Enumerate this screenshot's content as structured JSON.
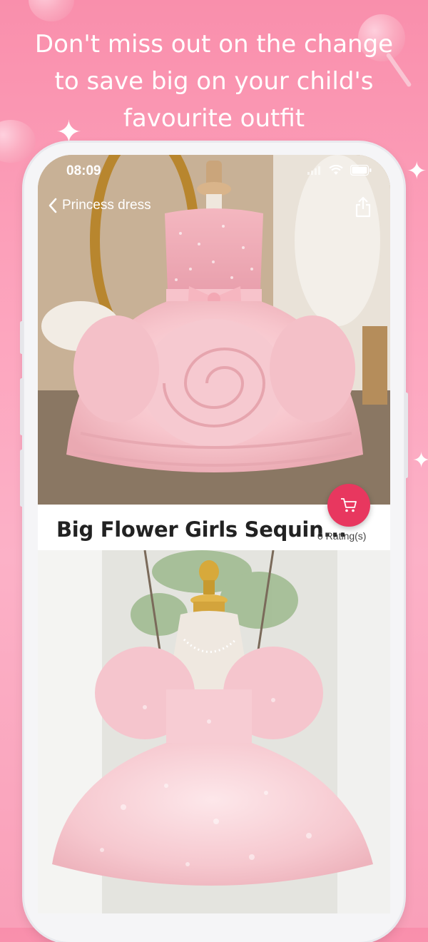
{
  "headline": "Don't miss out on the change to save big on your child's favourite outfit",
  "status_bar": {
    "time": "08:09",
    "icons": [
      "signal-icon",
      "wifi-icon",
      "battery-icon"
    ]
  },
  "nav": {
    "back_icon": "chevron-left-icon",
    "title": "Princess dress",
    "share_icon": "share-icon"
  },
  "product": {
    "title": "Big Flower Girls Sequin...",
    "rating": "0 Rating(s)",
    "cart_icon": "cart-icon"
  },
  "colors": {
    "background": "#fda5be",
    "accent": "#e8375f",
    "text": "#222222"
  }
}
